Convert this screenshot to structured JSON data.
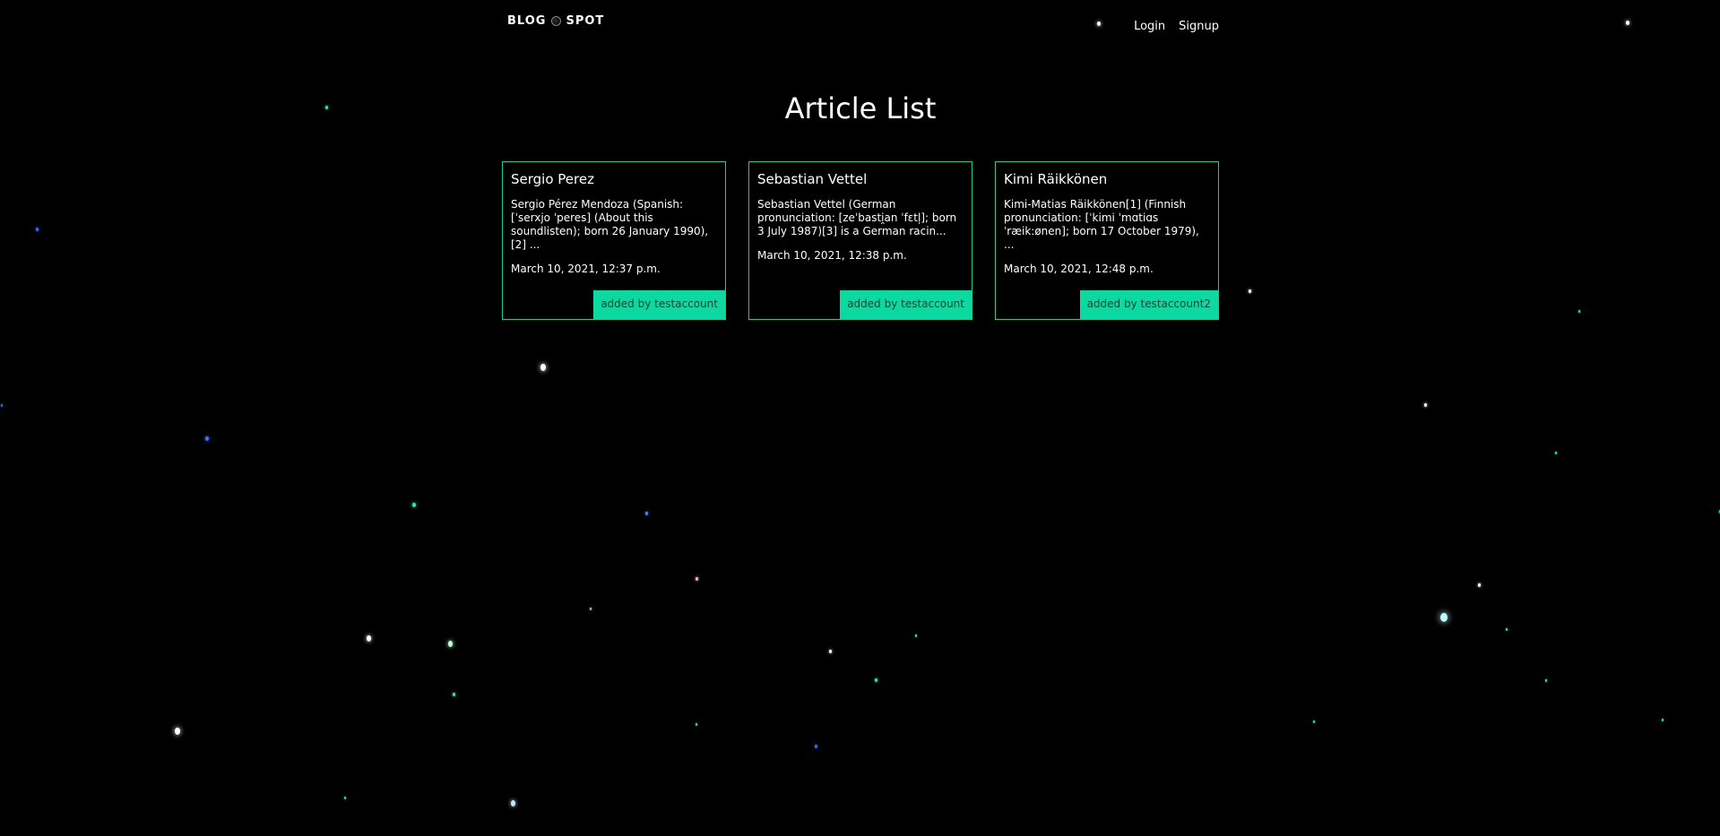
{
  "header": {
    "logo_left": "BLOG",
    "logo_right": "SPOT",
    "nav": {
      "login": "Login",
      "signup": "Signup"
    }
  },
  "main": {
    "title": "Article List",
    "articles": [
      {
        "title": "Sergio Perez",
        "snippet": "Sergio Pérez Mendoza (Spanish: [ˈserxjo ˈperes] (About this soundlisten); born 26 January 1990),[2] ...",
        "date": "March 10, 2021, 12:37 p.m.",
        "author": "added by testaccount"
      },
      {
        "title": "Sebastian Vettel",
        "snippet": "Sebastian Vettel (German pronunciation: [zeˈbasti̯an ˈfɛtl̩]; born 3 July 1987)[3] is a German racin...",
        "date": "March 10, 2021, 12:38 p.m.",
        "author": "added by testaccount"
      },
      {
        "title": "Kimi Räikkönen",
        "snippet": "Kimi-Matias Räikkönen[1] (Finnish pronunciation: [ˈkimi ˈmɑtiɑs ˈræik:ønen]; born 17 October 1979), ...",
        "date": "March 10, 2021, 12:48 p.m.",
        "author": "added by testaccount2"
      }
    ]
  },
  "colors": {
    "background": "#000000",
    "accent": "#0cd9a0",
    "border": "#1fc89b",
    "author_text": "#0b4a3b"
  }
}
